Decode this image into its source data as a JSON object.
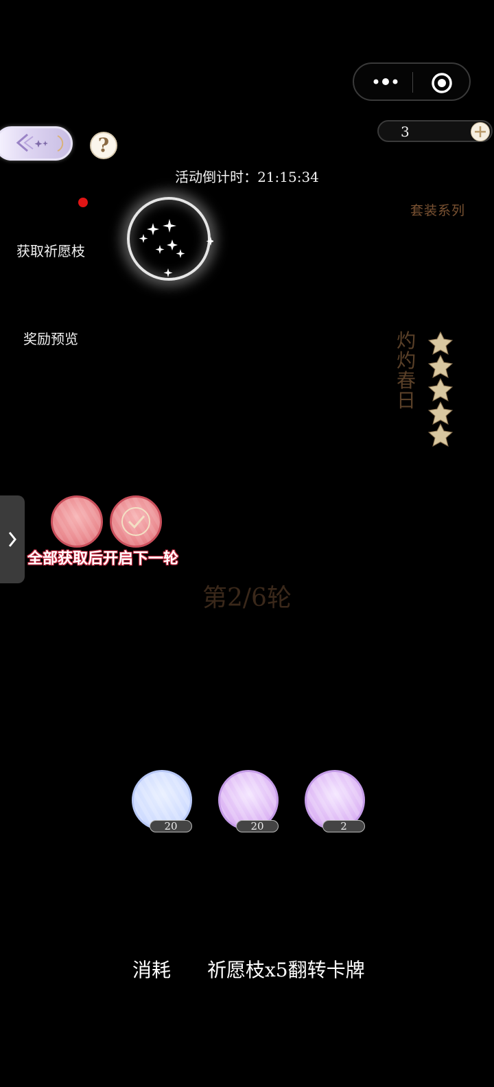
{
  "capsule": {
    "more_icon": "more-dots-icon",
    "close_icon": "target-circle-icon"
  },
  "currency": {
    "value": "3",
    "plus_icon": "plus-icon"
  },
  "help": {
    "label": "?"
  },
  "countdown": {
    "label": "活动倒计时：21:15:34"
  },
  "left_menu": {
    "get_branch": "获取祈愿枝",
    "reward_preview": "奖励预览"
  },
  "suit": {
    "series_label": "套装系列",
    "name": "灼灼春日",
    "star_count": 5
  },
  "rewards": {
    "next_round_notice": "全部获取后开启下一轮",
    "round_label": "第2/6轮",
    "items": [
      {
        "claimed": false,
        "color": "#eb8d92"
      },
      {
        "claimed": true,
        "color": "#eb8d92"
      }
    ]
  },
  "draw_items": [
    {
      "count": "20",
      "color": "#cfdcff"
    },
    {
      "count": "20",
      "color": "#dcb4f4"
    },
    {
      "count": "2",
      "color": "#dcb4f4"
    }
  ],
  "footer": {
    "consume_label": "消耗",
    "action_label": "祈愿枝x5翻转卡牌"
  }
}
